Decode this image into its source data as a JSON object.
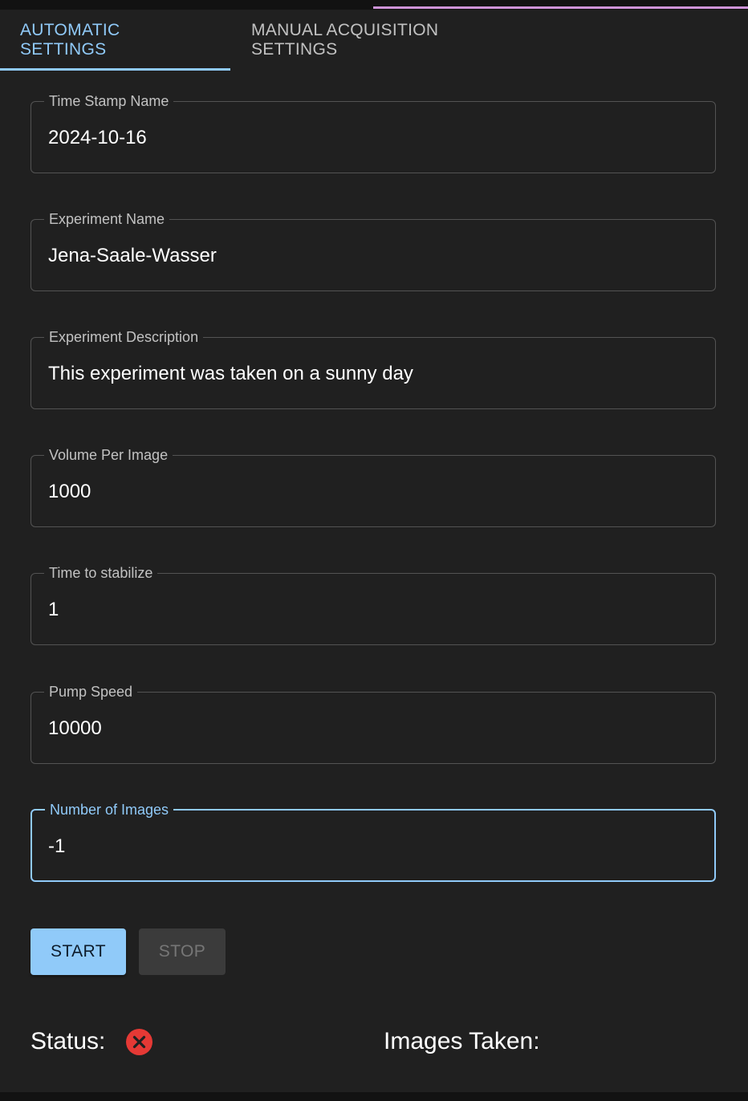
{
  "tabs": [
    {
      "label": "Automatic Settings",
      "active": true
    },
    {
      "label": "Manual Acquisition Settings",
      "active": false
    }
  ],
  "fields": {
    "time_stamp_name": {
      "label": "Time Stamp Name",
      "value": "2024-10-16"
    },
    "experiment_name": {
      "label": "Experiment Name",
      "value": "Jena-Saale-Wasser"
    },
    "experiment_description": {
      "label": "Experiment Description",
      "value": "This experiment was taken on a sunny day"
    },
    "volume_per_image": {
      "label": "Volume Per Image",
      "value": "1000"
    },
    "time_to_stabilize": {
      "label": "Time to stabilize",
      "value": "1"
    },
    "pump_speed": {
      "label": "Pump Speed",
      "value": "10000"
    },
    "number_of_images": {
      "label": "Number of Images",
      "value": "-1",
      "focused": true
    }
  },
  "buttons": {
    "start_label": "Start",
    "stop_label": "Stop",
    "stop_disabled": true
  },
  "status": {
    "label": "Status:",
    "icon": "error-x-icon",
    "icon_color": "#e53935"
  },
  "images_taken": {
    "label": "Images Taken:"
  },
  "colors": {
    "accent": "#90caf9",
    "top_accent": "#ce93d8",
    "panel_bg": "#202020",
    "page_bg": "#121212"
  }
}
